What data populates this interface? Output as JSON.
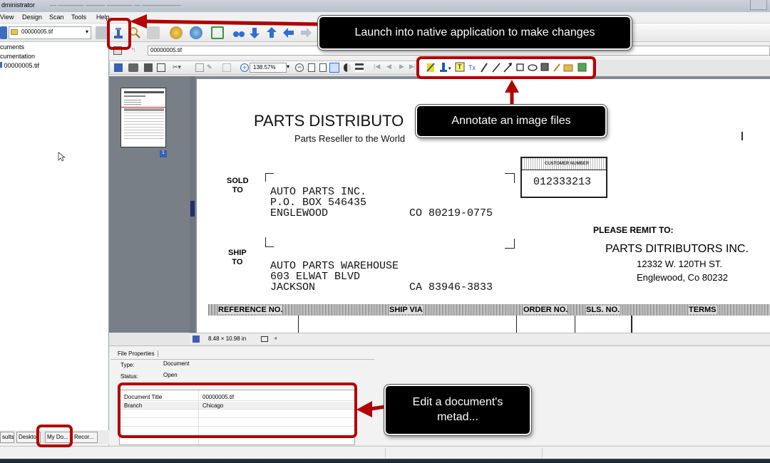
{
  "window": {
    "title": "dministrator",
    "title_suffix": "— ———— ——— ———— — ——————"
  },
  "menu": [
    "View",
    "Design",
    "Scan",
    "Tools",
    "Help"
  ],
  "folder": {
    "value": "00000005.tif"
  },
  "tree": [
    "cuments",
    "cumentation",
    "00000005.tif"
  ],
  "bottom_tabs": [
    "sults",
    "Deskto",
    "My Do...",
    "Recor..."
  ],
  "path": {
    "value": "00000005.tif"
  },
  "zoom": {
    "value": "138.57%"
  },
  "thumbnail": {
    "page_number": "1"
  },
  "document": {
    "company": "PARTS DISTRIBUTO",
    "tagline": "Parts Reseller to the World",
    "sold_to_label": "SOLD\nTO",
    "sold_line1": "AUTO PARTS INC.",
    "sold_line2": "P.O. BOX 546435",
    "sold_line3": "ENGLEWOOD",
    "sold_state": "CO 80219-0775",
    "ship_to_label": "SHIP\nTO",
    "ship_line1": "AUTO PARTS WAREHOUSE",
    "ship_line2": "603 ELWAT BLVD",
    "ship_line3": "JACKSON",
    "ship_state": "CA 83946-3833",
    "customer_number_label": "CUSTOMER NUMBER",
    "customer_number": "012333213",
    "remit_label": "PLEASE REMIT TO:",
    "remit_name": "PARTS DITRIBUTORS INC.",
    "remit_street": "12332 W. 120TH ST.",
    "remit_city": "Englewood, Co 80232",
    "table_headers": [
      "REFERENCE NO.",
      "SHIP VIA",
      "ORDER NO.",
      "SLS. NO.",
      "TERMS"
    ]
  },
  "page_size": "8.48 × 10.98 in",
  "file_properties": {
    "tab": "File Properties",
    "type_label": "Type:",
    "type_value": "Document",
    "status_label": "Status:",
    "status_value": "Open"
  },
  "metadata": [
    {
      "name": "Document Title",
      "value": "00000005.tif"
    },
    {
      "name": "Branch",
      "value": "Chicago"
    }
  ],
  "callouts": {
    "launch": "Launch into native application to make changes",
    "annotate": "Annotate an image files",
    "metadata": "Edit a document's metad..."
  },
  "colors": {
    "highlight": "#b40000",
    "callout_bg": "#000000",
    "accent": "#2e6fd1"
  }
}
